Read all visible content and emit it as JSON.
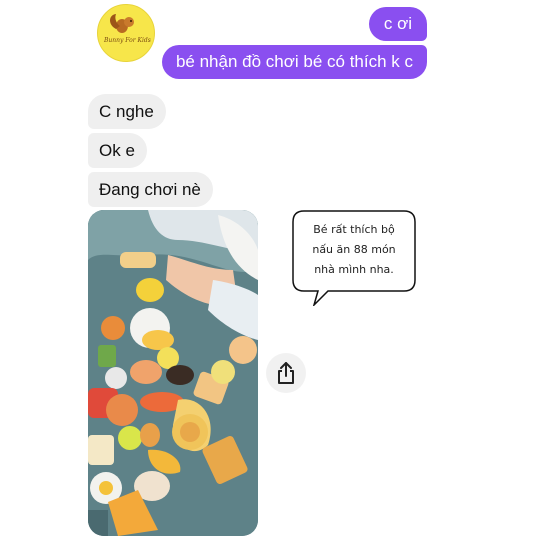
{
  "contact": {
    "avatar_icon": "squirrel-logo-icon",
    "logo_text": "Bunny For Kids",
    "logo_bg": "#f7e64a"
  },
  "messages": {
    "outgoing": [
      {
        "text": "c ơi"
      },
      {
        "text": "bé nhận đồ chơi bé có thích k c"
      }
    ],
    "incoming": [
      {
        "text": "C nghe"
      },
      {
        "text": "Ok e"
      },
      {
        "text": "Đang chơi nè"
      }
    ],
    "photo": {
      "icon": "toy-food-photo"
    }
  },
  "note": {
    "line1": "Bé rất thích bộ",
    "line2": "nấu ăn 88 món",
    "line3": "nhà mình nha."
  },
  "share": {
    "icon": "share-icon"
  },
  "colors": {
    "outgoing_bubble": "#8a4ff0",
    "incoming_bubble": "#efefef",
    "background": "#ffffff"
  }
}
